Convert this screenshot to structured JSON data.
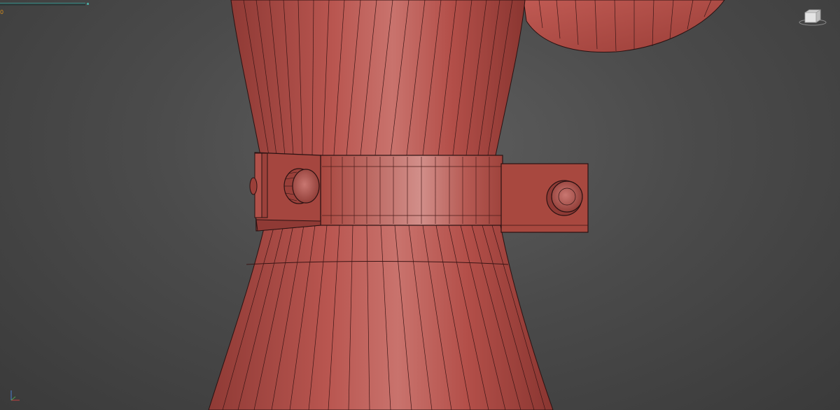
{
  "viewport": {
    "stats_label": "0"
  },
  "colors": {
    "background": "#4b4b4b",
    "mesh_base": "#b9514a",
    "mesh_dark": "#8f3a35",
    "mesh_highlight": "#d98d88",
    "wire": "#2a1212",
    "hud_orange": "#d08a1e",
    "hud_teal": "#3e8f8a"
  },
  "icons": {
    "viewcube": "viewcube-icon",
    "axis": "axis-tripod-icon"
  }
}
